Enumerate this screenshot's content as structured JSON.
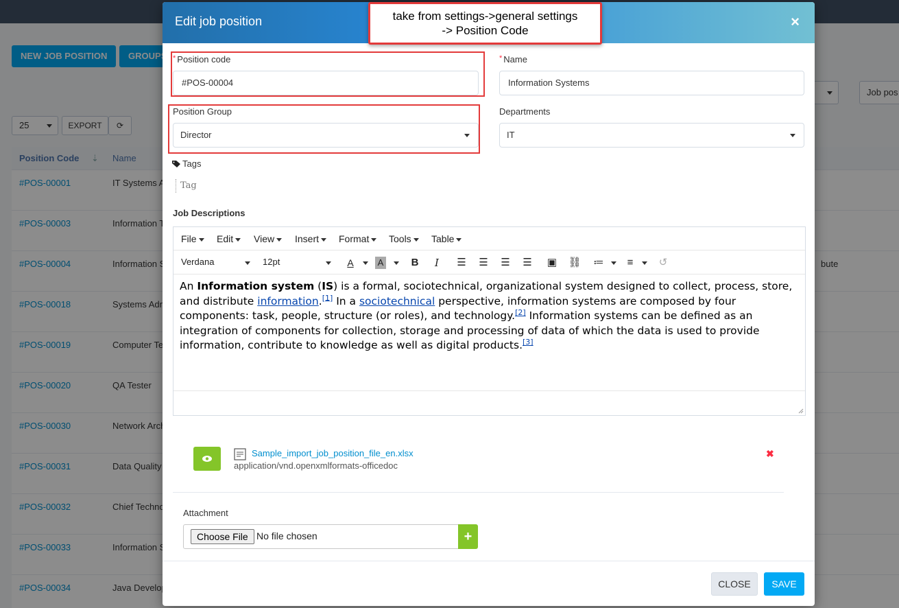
{
  "background": {
    "buttons": [
      "NEW JOB POSITION",
      "GROUPS"
    ],
    "page_size": "25",
    "export_label": "EXPORT",
    "filter_placeholder": "Job pos",
    "table_headers": [
      "Position Code",
      "Name"
    ],
    "rows": [
      {
        "code": "#POS-00001",
        "name": "IT Systems A",
        "extra": ""
      },
      {
        "code": "#POS-00003",
        "name": "Information T",
        "extra": ""
      },
      {
        "code": "#POS-00004",
        "name": "Information S",
        "extra": "bute"
      },
      {
        "code": "#POS-00018",
        "name": "Systems Adm",
        "extra": ""
      },
      {
        "code": "#POS-00019",
        "name": "Computer Te",
        "extra": ""
      },
      {
        "code": "#POS-00020",
        "name": "QA Tester",
        "extra": ""
      },
      {
        "code": "#POS-00030",
        "name": "Network Arch",
        "extra": ""
      },
      {
        "code": "#POS-00031",
        "name": "Data Quality",
        "extra": ""
      },
      {
        "code": "#POS-00032",
        "name": "Chief Techno",
        "extra": ""
      },
      {
        "code": "#POS-00033",
        "name": "Information S",
        "extra": ""
      },
      {
        "code": "#POS-00034",
        "name": "Java Develop",
        "extra": ""
      }
    ]
  },
  "modal": {
    "title": "Edit job position",
    "close_glyph": "×",
    "position_code": {
      "label": "Position code",
      "value": "#POS-00004"
    },
    "name": {
      "label": "Name",
      "value": "Information Systems"
    },
    "position_group": {
      "label": "Position Group",
      "value": "Director"
    },
    "departments": {
      "label": "Departments",
      "value": "IT"
    },
    "tags": {
      "label": "Tags",
      "placeholder": "Tag"
    },
    "job_descriptions": {
      "label": "Job Descriptions",
      "menu": [
        "File",
        "Edit",
        "View",
        "Insert",
        "Format",
        "Tools",
        "Table"
      ],
      "font_family": "Verdana",
      "font_size": "12pt",
      "content": {
        "p1": "An ",
        "bold1": "Information system",
        "p2": " (",
        "bold2": "IS",
        "p3": ") is a formal, sociotechnical, organizational system designed to collect, process, store, and distribute ",
        "link1": "information",
        "p4": ".",
        "ref1": "[1]",
        "p5": " In a ",
        "link2": "sociotechnical",
        "p6": " perspective, information systems are composed by four components: task, people, structure (or roles), and technology.",
        "ref2": "[2]",
        "p7": " Information systems can be defined as an integration of components for collection, storage and processing of data of which the data is used to provide information, contribute to knowledge as well as digital products.",
        "ref3": "[3]"
      }
    },
    "file": {
      "name": "Sample_import_job_position_file_en.xlsx",
      "type": "application/vnd.openxmlformats-officedoc",
      "delete_glyph": "✖"
    },
    "attachment": {
      "label": "Attachment",
      "choose_label": "Choose File",
      "status": "No file chosen",
      "add_glyph": "+"
    },
    "footer": {
      "close_label": "CLOSE",
      "save_label": "SAVE"
    }
  },
  "annotation": {
    "callout_line1": "take from settings->general settings",
    "callout_line2": "-> Position Code",
    "color": "#e33a3a"
  }
}
